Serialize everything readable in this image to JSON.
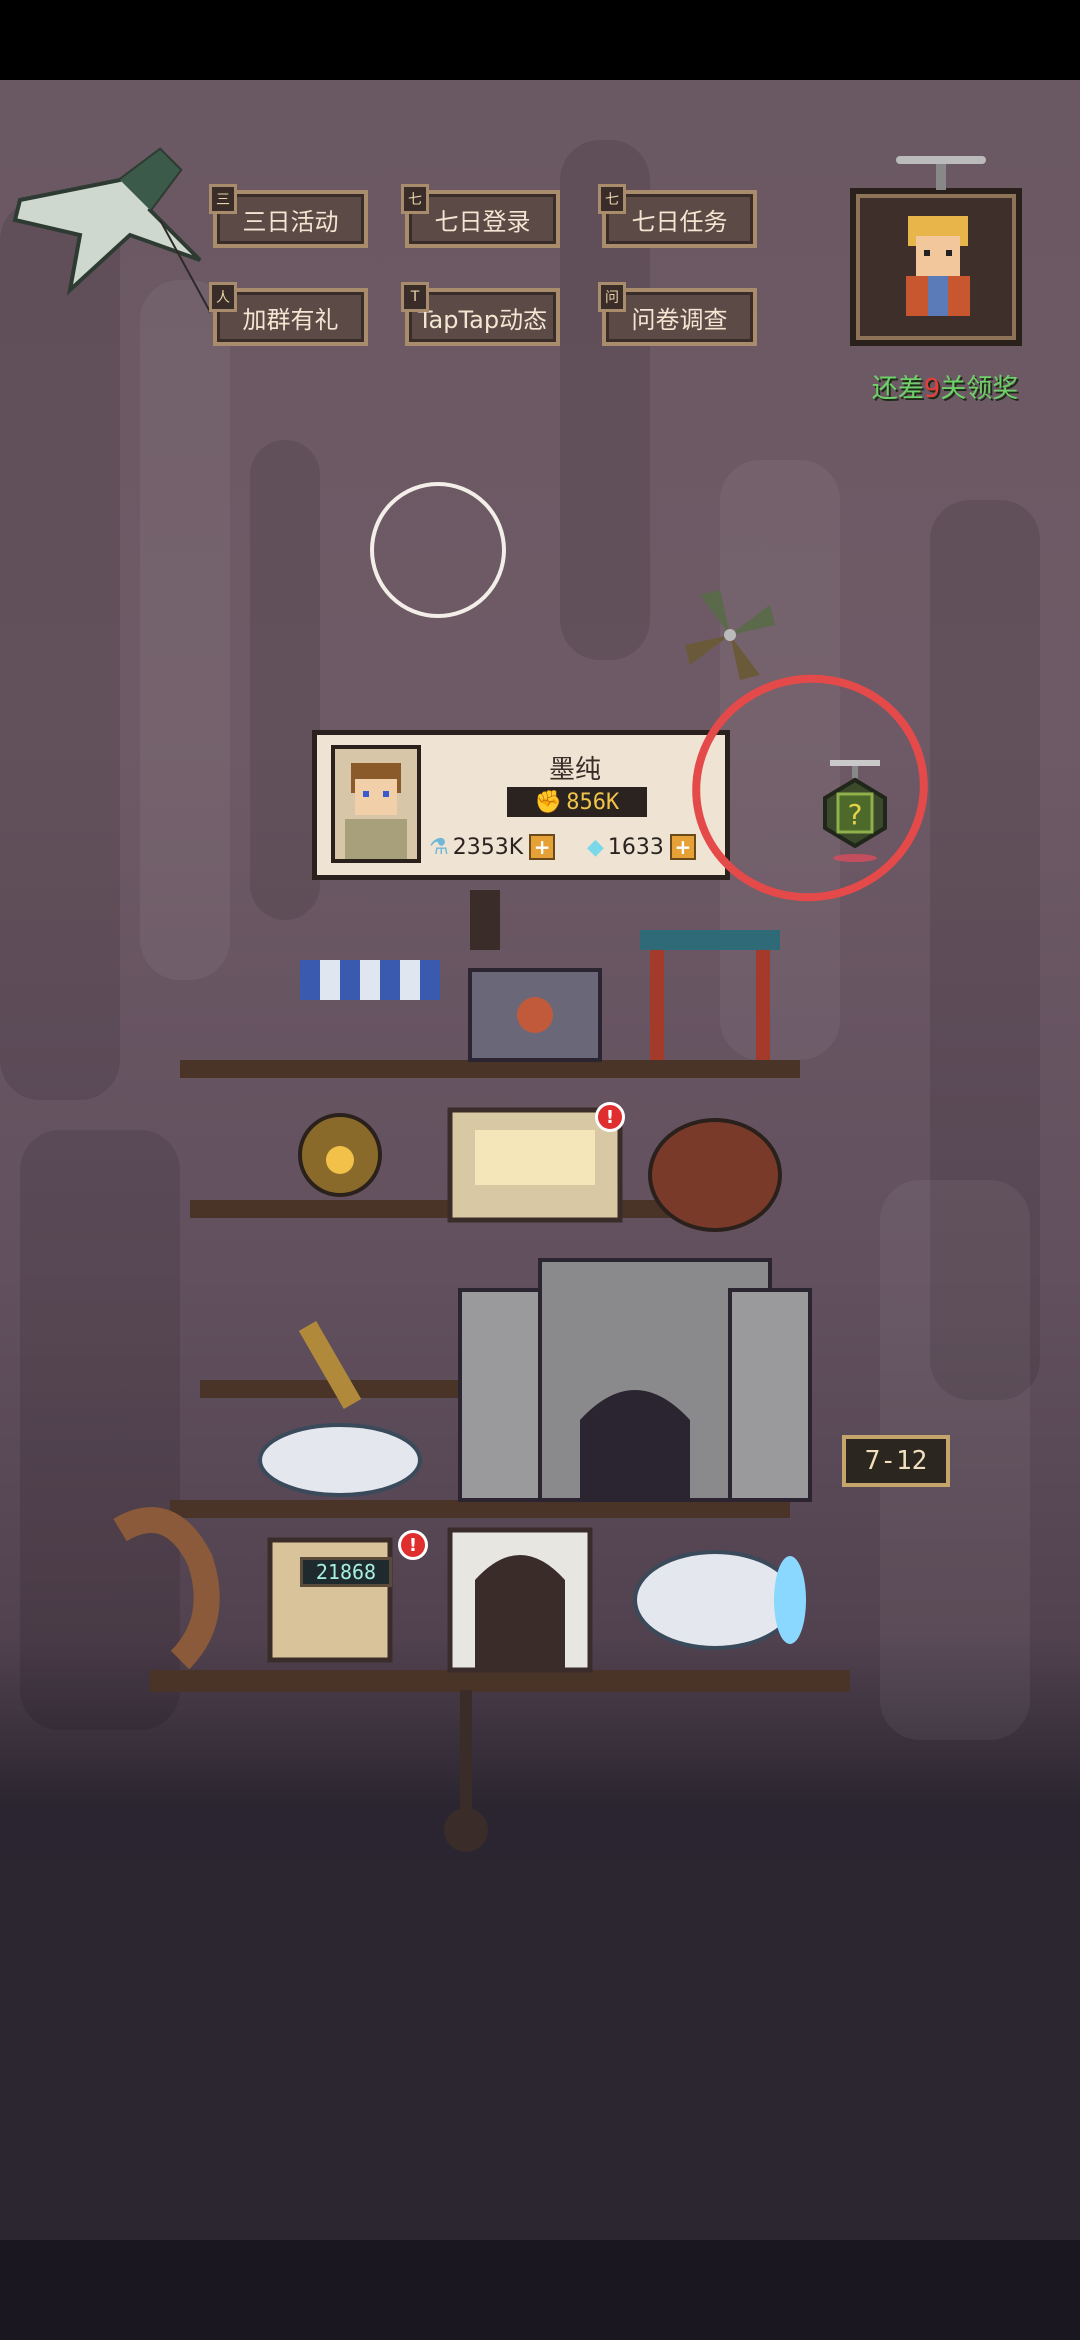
{
  "menu": {
    "row1": [
      {
        "label": "三日活动",
        "tag": "三"
      },
      {
        "label": "七日登录",
        "tag": "七"
      },
      {
        "label": "七日任务",
        "tag": "七"
      }
    ],
    "row2": [
      {
        "label": "加群有礼",
        "tag": "人"
      },
      {
        "label": "TapTap动态",
        "tag": "T"
      },
      {
        "label": "问卷调查",
        "tag": "问"
      }
    ]
  },
  "reward": {
    "prefix": "还差",
    "count": "9",
    "suffix": "关领奖"
  },
  "player": {
    "name": "墨纯",
    "power": "856K",
    "potion": "2353K",
    "diamond": "1633"
  },
  "tower": {
    "level_sign": "7-12",
    "counter": "21868",
    "alert_badge": "!"
  },
  "icons": {
    "power": "fist-icon",
    "potion": "potion-bottle-icon",
    "diamond": "diamond-icon",
    "mystery": "question-drone-icon"
  },
  "colors": {
    "reward_green": "#6fd06a",
    "reward_red": "#e83b3b",
    "highlight_circle": "#e44a4a",
    "plus_orange": "#e5a136"
  }
}
